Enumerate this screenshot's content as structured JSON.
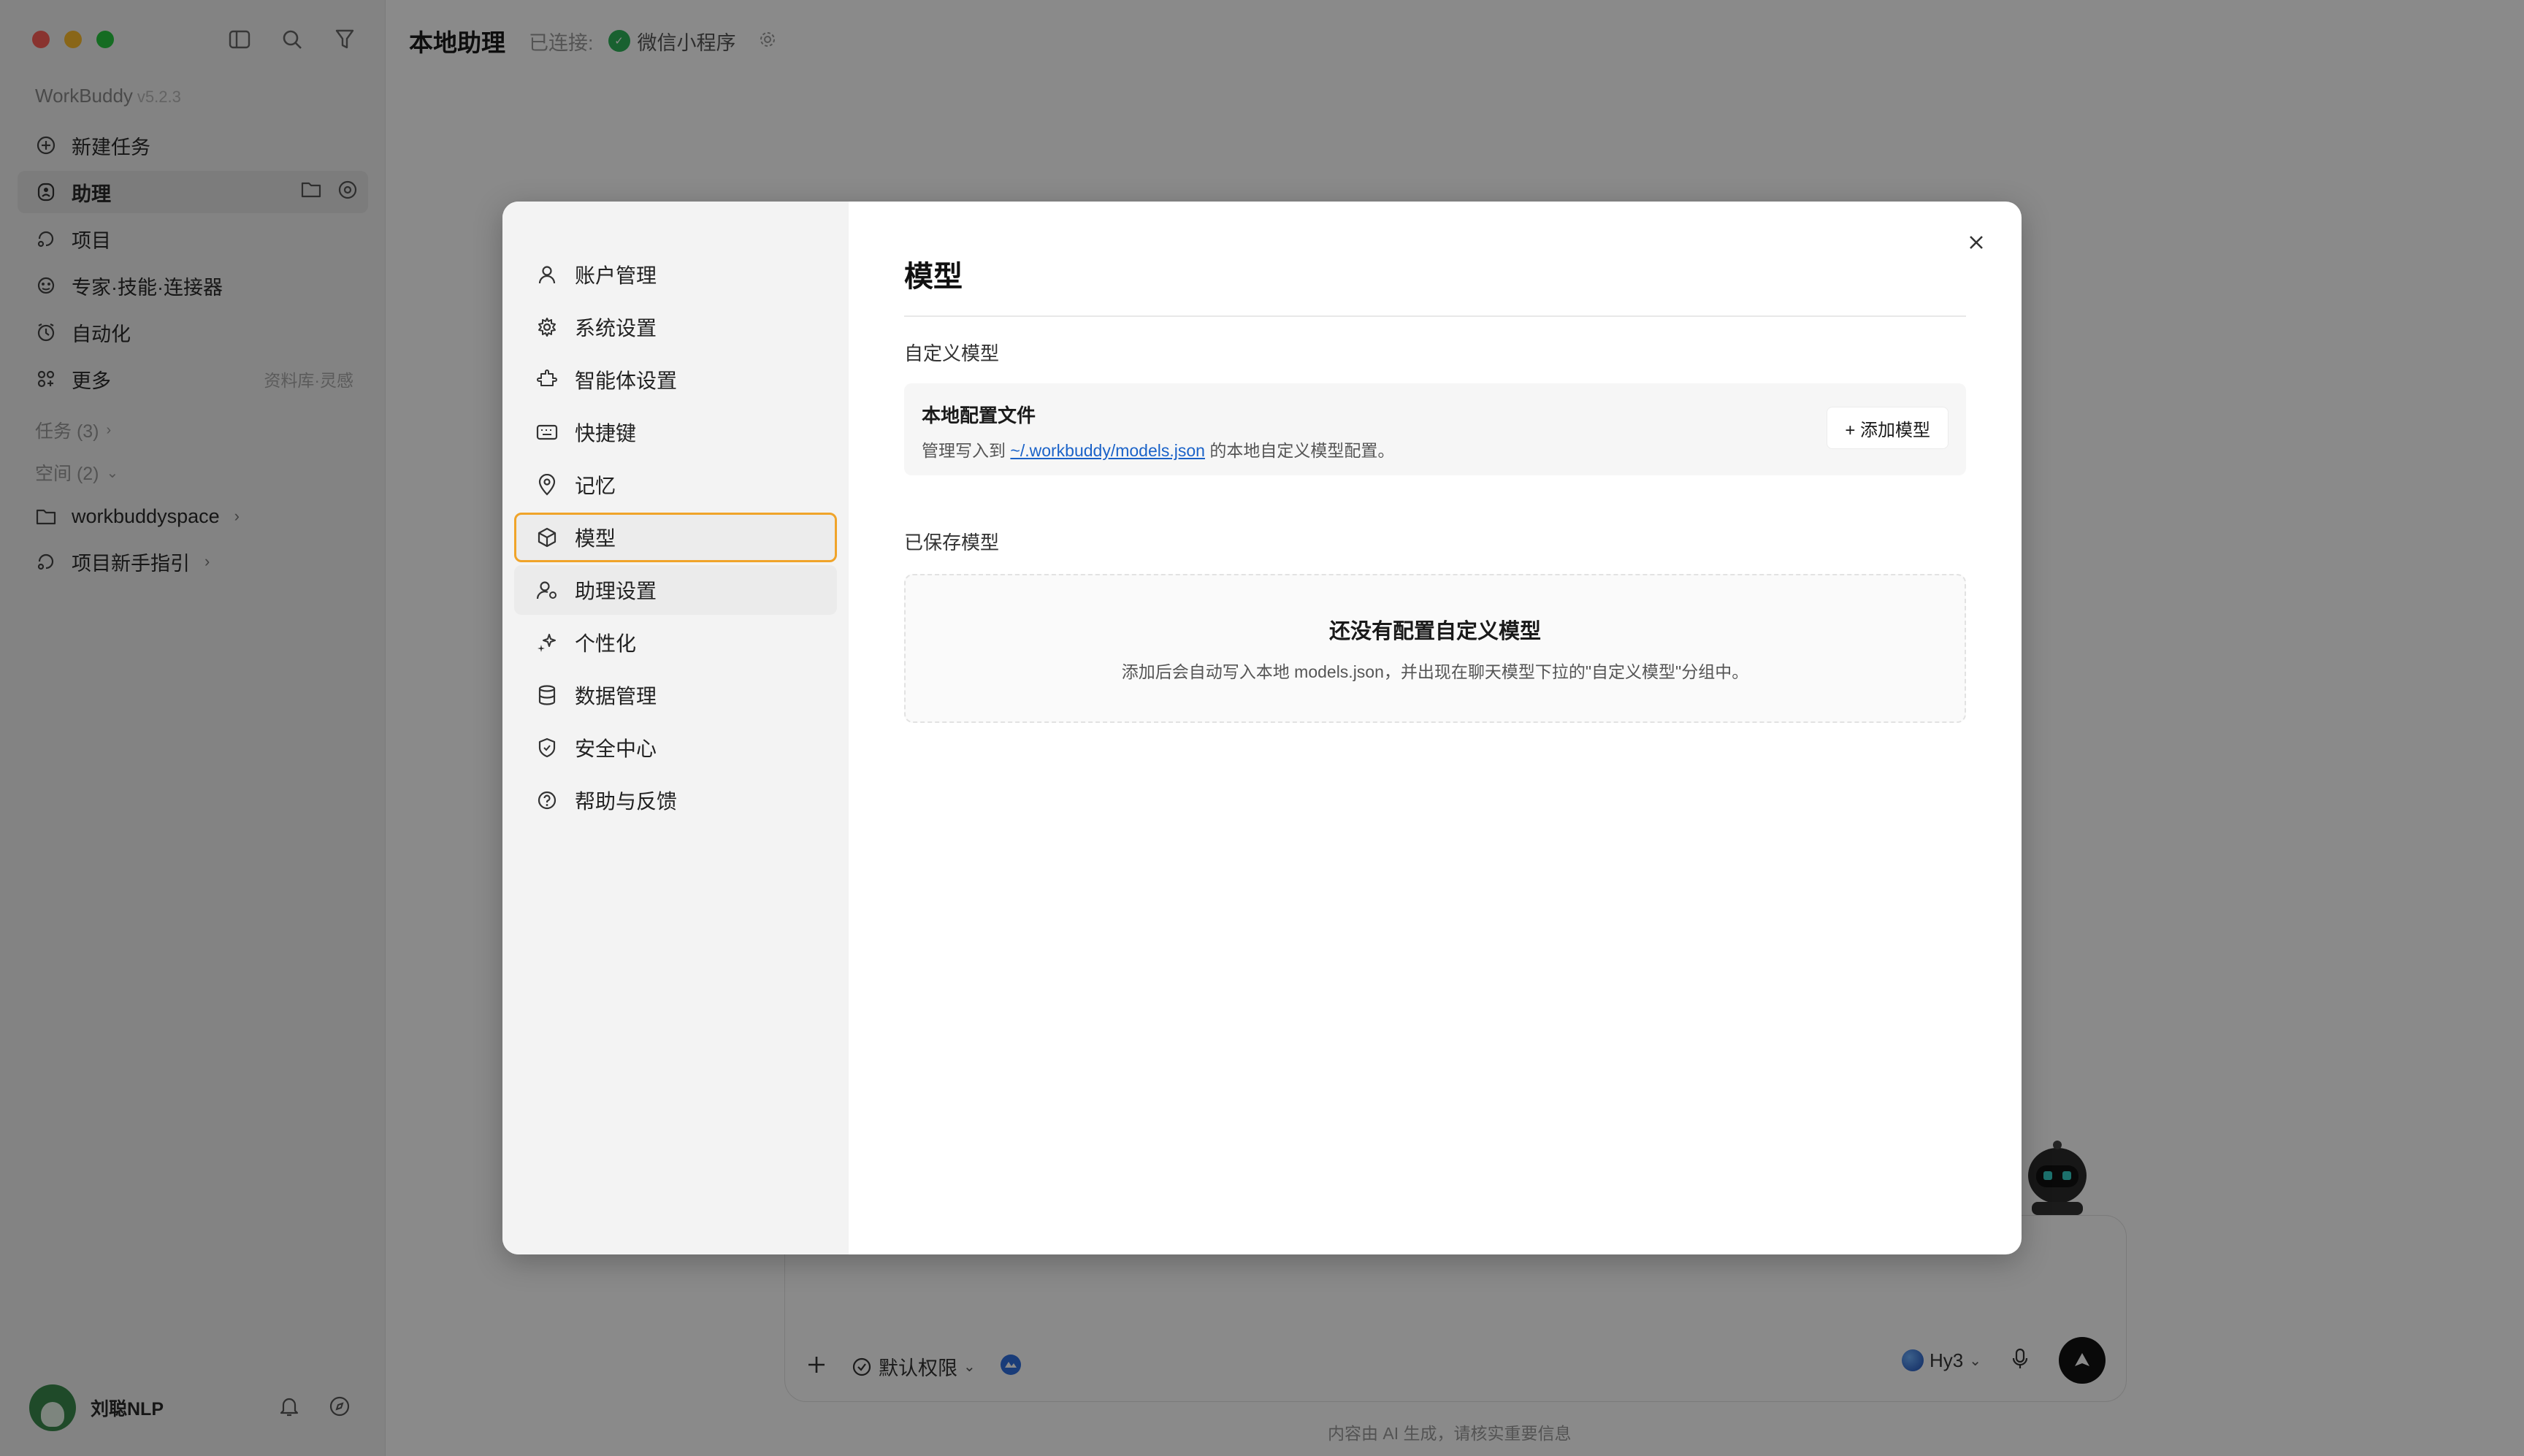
{
  "app": {
    "name": "WorkBuddy",
    "version": "v5.2.3"
  },
  "sidebar": {
    "nav": [
      {
        "label": "新建任务",
        "icon": "plus-circle-icon"
      },
      {
        "label": "助理",
        "icon": "assistant-icon",
        "active": true
      },
      {
        "label": "项目",
        "icon": "project-icon"
      },
      {
        "label": "专家·技能·连接器",
        "icon": "expert-icon"
      },
      {
        "label": "自动化",
        "icon": "clock-icon"
      },
      {
        "label": "更多",
        "icon": "grid-icon",
        "extra": "资料库·灵感"
      }
    ],
    "tasks_label": "任务 (3)",
    "spaces_label": "空间 (2)",
    "spaces": [
      {
        "label": "workbuddyspace",
        "icon": "folder-icon"
      },
      {
        "label": "项目新手指引",
        "icon": "project-icon"
      }
    ],
    "user_name": "刘聪NLP"
  },
  "header": {
    "title": "本地助理",
    "connected_label": "已连接:",
    "connection": "微信小程序"
  },
  "chat": {
    "permission_label": "默认权限",
    "model_label": "Hy3",
    "footer_note": "内容由 AI 生成，请核实重要信息"
  },
  "modal": {
    "menu": [
      {
        "label": "账户管理",
        "icon": "user-icon"
      },
      {
        "label": "系统设置",
        "icon": "gear-icon"
      },
      {
        "label": "智能体设置",
        "icon": "agent-icon"
      },
      {
        "label": "快捷键",
        "icon": "keyboard-icon"
      },
      {
        "label": "记忆",
        "icon": "memory-icon"
      },
      {
        "label": "模型",
        "icon": "cube-icon",
        "selected": true
      },
      {
        "label": "助理设置",
        "icon": "user-settings-icon",
        "hover": true
      },
      {
        "label": "个性化",
        "icon": "sparkle-icon"
      },
      {
        "label": "数据管理",
        "icon": "database-icon"
      },
      {
        "label": "安全中心",
        "icon": "shield-icon"
      },
      {
        "label": "帮助与反馈",
        "icon": "help-icon"
      }
    ],
    "title": "模型",
    "custom_section": "自定义模型",
    "config_card": {
      "title": "本地配置文件",
      "desc_prefix": "管理写入到 ",
      "desc_link": "~/.workbuddy/models.json",
      "desc_suffix": " 的本地自定义模型配置。",
      "add_button": "+ 添加模型"
    },
    "saved_section": "已保存模型",
    "empty": {
      "title": "还没有配置自定义模型",
      "desc": "添加后会自动写入本地 models.json，并出现在聊天模型下拉的\"自定义模型\"分组中。"
    }
  },
  "colors": {
    "selected_border": "#f0a42a",
    "link": "#1a62c8",
    "overlay": "rgba(0,0,0,0.46)"
  }
}
